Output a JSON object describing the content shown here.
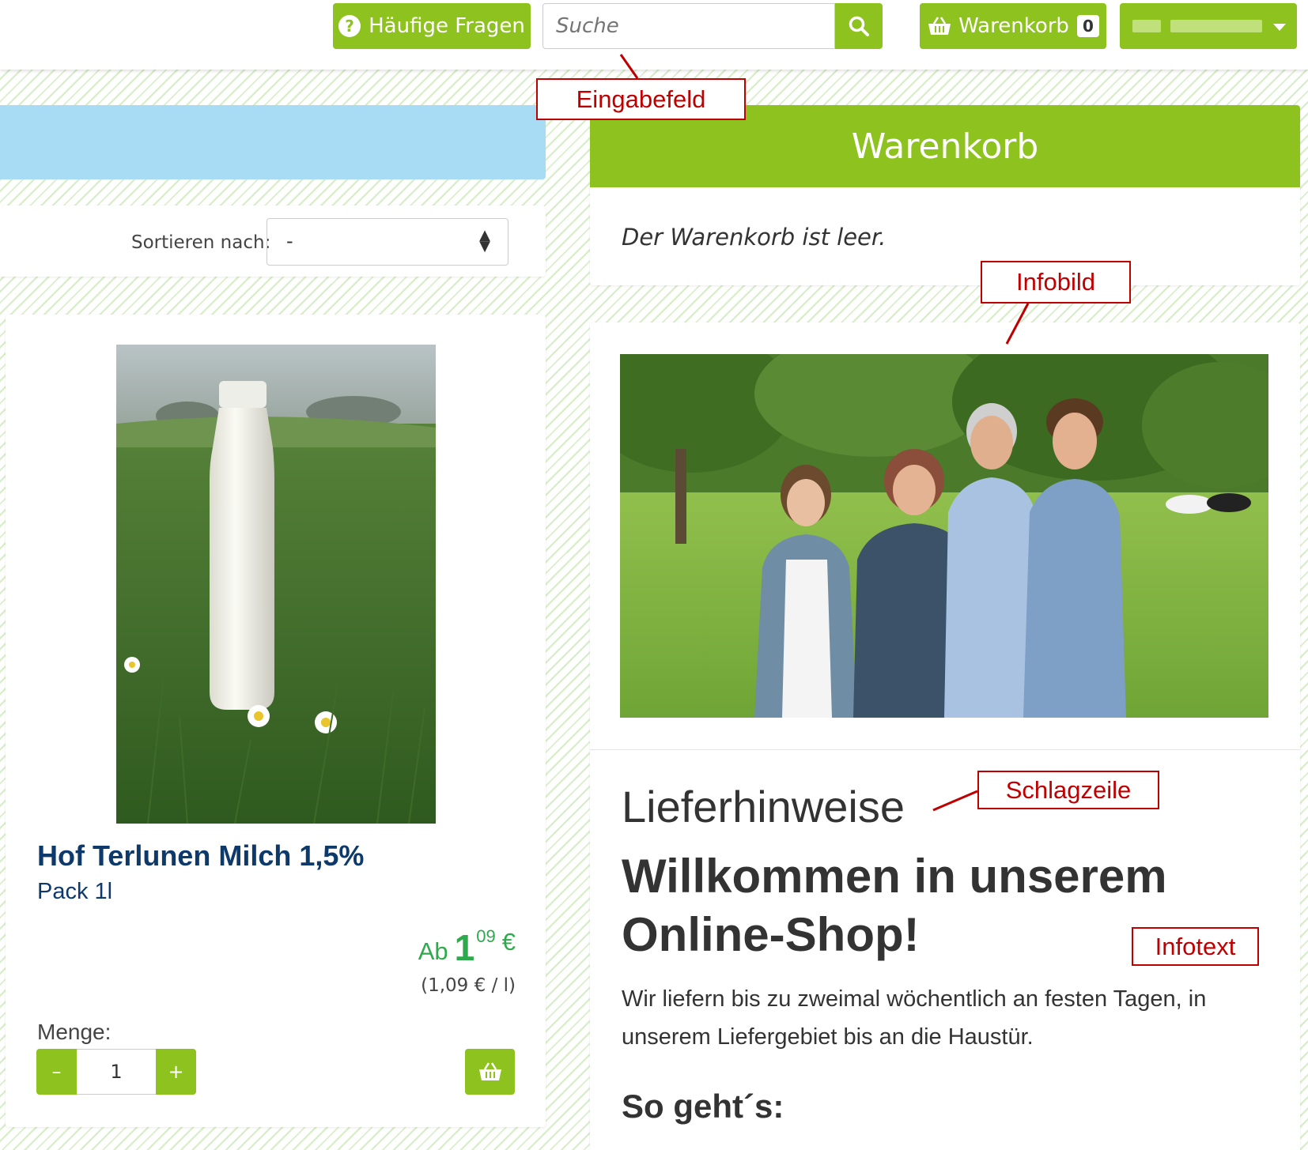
{
  "header": {
    "faq_label": "Häufige Fragen",
    "search_placeholder": "Suche",
    "cart_label": "Warenkorb",
    "cart_count": "0"
  },
  "annotations": {
    "eingabefeld": "Eingabefeld",
    "infobild": "Infobild",
    "schlagzeile": "Schlagzeile",
    "infotext": "Infotext"
  },
  "sort": {
    "label": "Sortieren nach:",
    "selected": "-"
  },
  "product": {
    "title": "Hof Terlunen Milch 1,5%",
    "unit": "Pack 1l",
    "price_prefix": "Ab",
    "price_int": "1",
    "price_dec": "09",
    "currency": "€",
    "unit_price": "(1,09 € / l)",
    "quantity_label": "Menge:",
    "quantity": "1",
    "minus": "–",
    "plus": "+"
  },
  "cart": {
    "title": "Warenkorb",
    "empty_text": "Der Warenkorb ist leer."
  },
  "info": {
    "heading": "Lieferhinweise",
    "welcome": "Willkommen in unserem Online-Shop!",
    "text": "Wir liefern bis zu zweimal wöchentlich an festen Tagen, in unserem Liefergebiet bis an die Haustür.",
    "subheading": "So geht´s:"
  },
  "colors": {
    "accent": "#8dc21f",
    "product_title": "#0d3a6b",
    "price": "#2eaa4c",
    "annotation": "#c00000",
    "banner": "#a8dcf5"
  }
}
